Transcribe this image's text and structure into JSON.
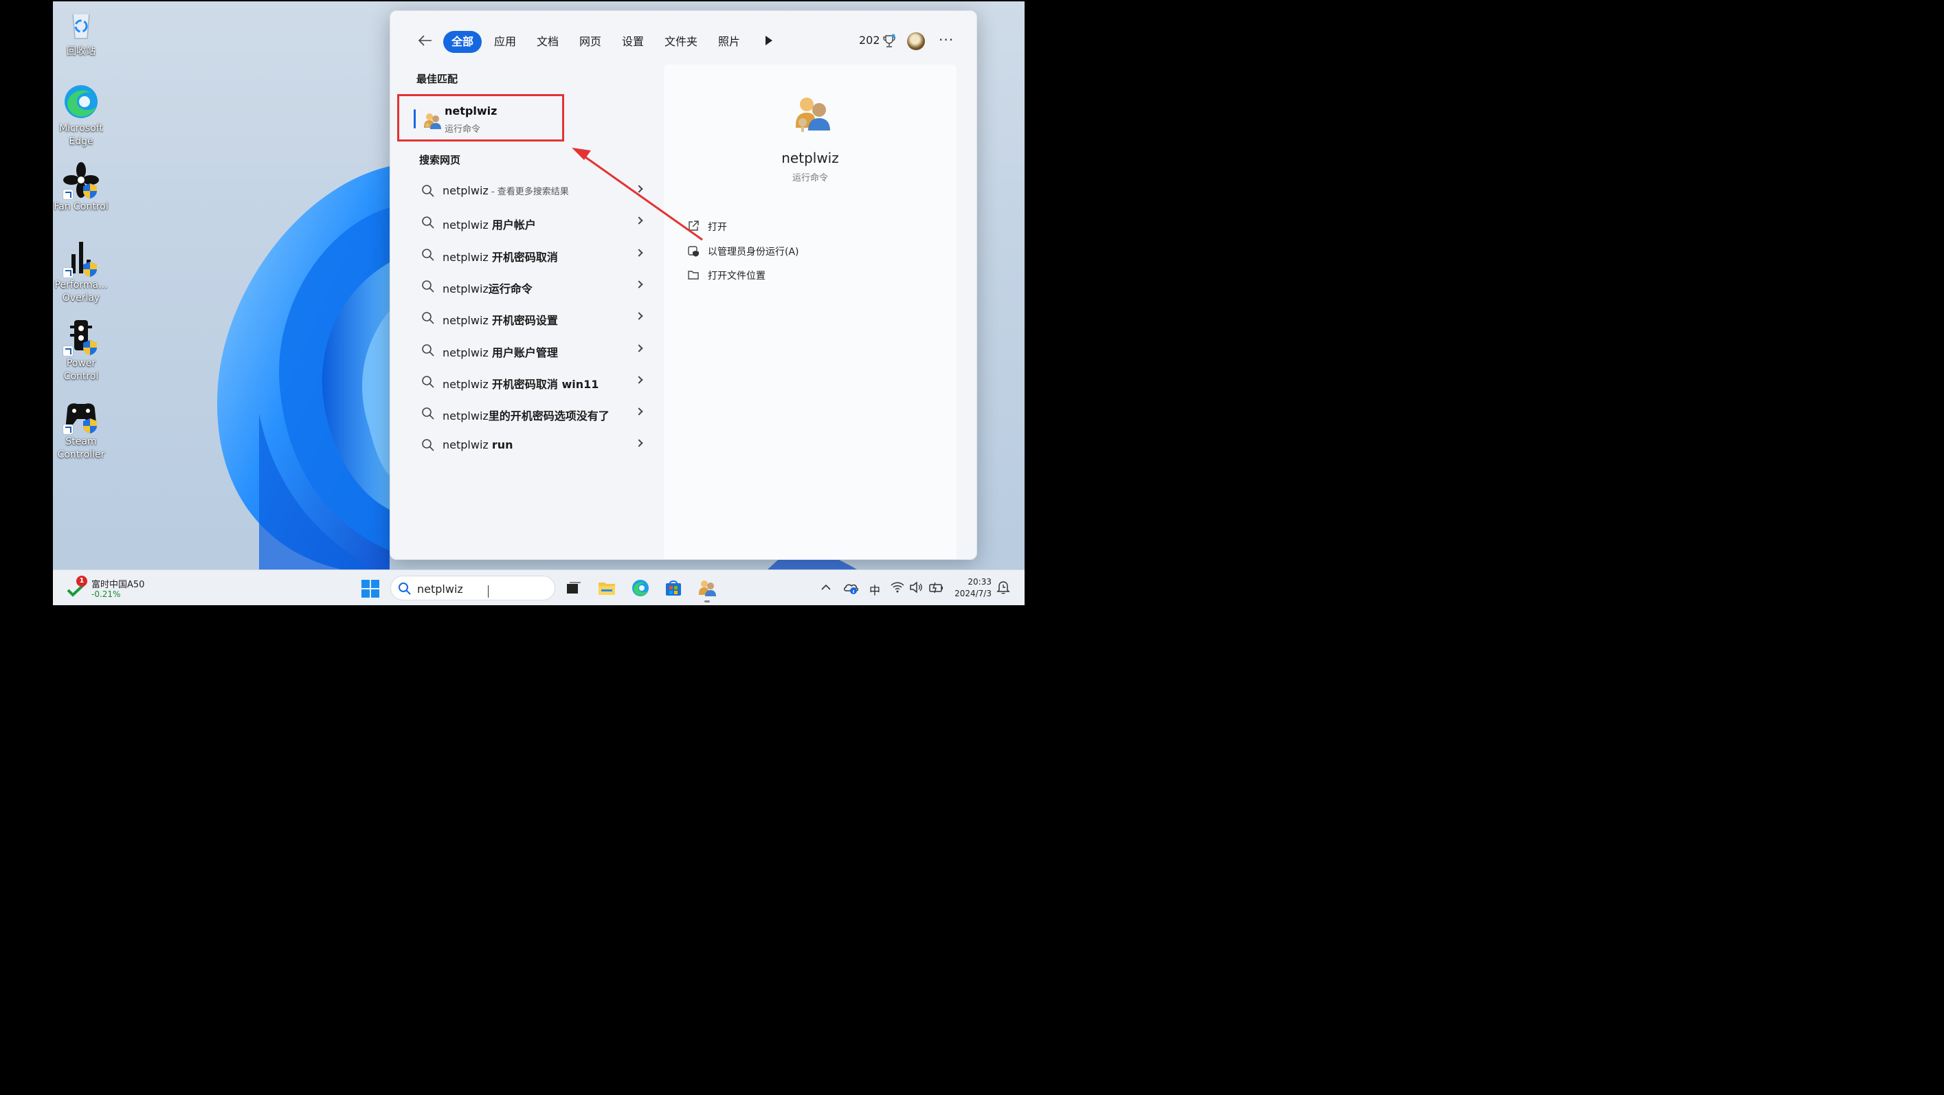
{
  "desktop": {
    "icons": [
      {
        "label_lines": [
          "回收站"
        ],
        "icon": "recycle-bin-icon"
      },
      {
        "label_lines": [
          "Microsoft",
          "Edge"
        ],
        "icon": "edge-icon"
      },
      {
        "label_lines": [
          "Fan Control"
        ],
        "icon": "fan-control-icon"
      },
      {
        "label_lines": [
          "Performa...",
          "Overlay"
        ],
        "icon": "performance-overlay-icon"
      },
      {
        "label_lines": [
          "Power",
          "Control"
        ],
        "icon": "power-control-icon"
      },
      {
        "label_lines": [
          "Steam",
          "Controller"
        ],
        "icon": "steam-controller-icon"
      }
    ]
  },
  "search_panel": {
    "tabs": [
      "全部",
      "应用",
      "文档",
      "网页",
      "设置",
      "文件夹",
      "照片"
    ],
    "active_tab": "全部",
    "points": "202",
    "more": "···",
    "best_match": {
      "section_title": "最佳匹配",
      "name": "netplwiz",
      "type": "运行命令"
    },
    "web": {
      "section_title": "搜索网页",
      "suggestions": [
        {
          "prefix": "netplwiz",
          "bold": "",
          "light": " - 查看更多搜索结果"
        },
        {
          "prefix": "netplwiz ",
          "bold": "用户帐户",
          "light": ""
        },
        {
          "prefix": "netplwiz ",
          "bold": "开机密码取消",
          "light": ""
        },
        {
          "prefix": "netplwiz",
          "bold": "运行命令",
          "light": ""
        },
        {
          "prefix": "netplwiz ",
          "bold": "开机密码设置",
          "light": ""
        },
        {
          "prefix": "netplwiz ",
          "bold": "用户账户管理",
          "light": ""
        },
        {
          "prefix": "netplwiz ",
          "bold": "开机密码取消 win11",
          "light": ""
        },
        {
          "prefix": "netplwiz",
          "bold": "里的开机密码选项没有了",
          "light": ""
        },
        {
          "prefix": "netplwiz ",
          "bold": "run",
          "light": ""
        }
      ]
    },
    "detail": {
      "name": "netplwiz",
      "type": "运行命令",
      "actions": [
        {
          "label": "打开",
          "icon": "open-external-icon"
        },
        {
          "label": "以管理员身份运行(A)",
          "icon": "run-as-admin-icon"
        },
        {
          "label": "打开文件位置",
          "icon": "folder-icon"
        }
      ]
    }
  },
  "taskbar": {
    "stock": {
      "badge": "1",
      "title": "富时中国A50",
      "change": "-0.21%"
    },
    "search_value": "netplwiz",
    "tray": {
      "ime": "中"
    },
    "clock": {
      "time": "20:33",
      "date": "2024/7/3"
    }
  },
  "colors": {
    "accent": "#1668e0",
    "highlight_box": "#e33333",
    "stock_down": "#1a8a2e"
  }
}
